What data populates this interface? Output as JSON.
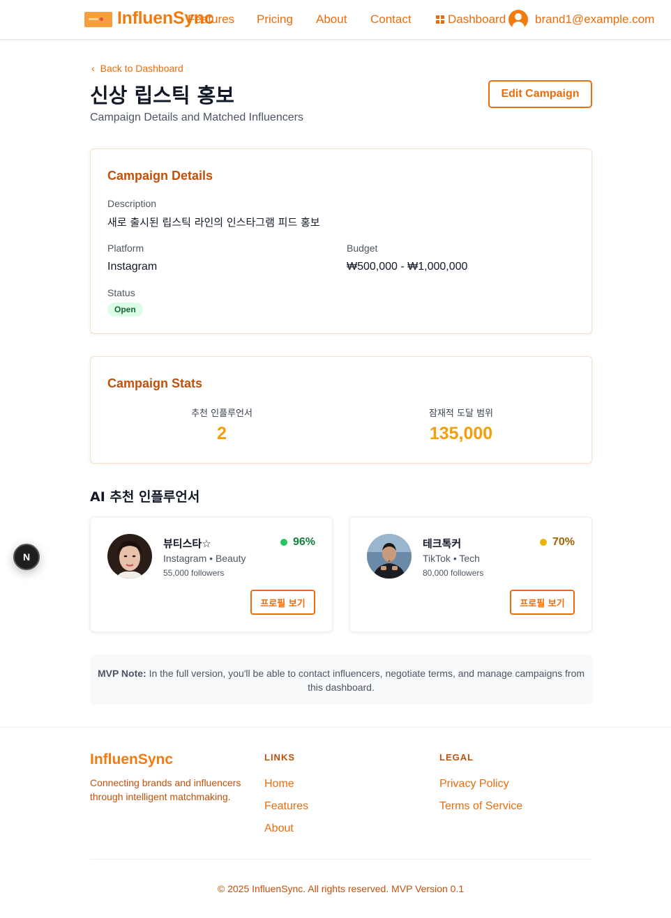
{
  "header": {
    "brand": "InfluenSync",
    "nav": [
      "Features",
      "Pricing",
      "About",
      "Contact"
    ],
    "dashboard_label": "Dashboard",
    "user_email": "brand1@example.com"
  },
  "page": {
    "back_label": "Back to Dashboard",
    "title": "신상 립스틱 홍보",
    "subtitle": "Campaign Details and Matched Influencers",
    "edit_button": "Edit Campaign"
  },
  "details": {
    "title": "Campaign Details",
    "description_label": "Description",
    "description": "새로 출시된 립스틱 라인의 인스타그램 피드 홍보",
    "platform_label": "Platform",
    "platform": "Instagram",
    "budget_label": "Budget",
    "budget": "₩500,000 - ₩1,000,000",
    "status_label": "Status",
    "status": "Open"
  },
  "stats": {
    "title": "Campaign Stats",
    "recommended_label": "추천 인플루언서",
    "recommended_value": "2",
    "reach_label": "잠재적 도달 범위",
    "reach_value": "135,000"
  },
  "influencers": {
    "title": "AI 추천 인플루언서",
    "items": [
      {
        "name": "뷰티스타☆",
        "platform": "Instagram",
        "category": "Beauty",
        "followers": "55,000 followers",
        "match": "96%",
        "match_color": "#22c55e",
        "match_text_color": "#15803d",
        "button": "프로필 보기"
      },
      {
        "name": "테크톡커",
        "platform": "TikTok",
        "category": "Tech",
        "followers": "80,000 followers",
        "match": "70%",
        "match_color": "#eab308",
        "match_text_color": "#a16207",
        "button": "프로필 보기"
      }
    ]
  },
  "mvp_note": {
    "label": "MVP Note:",
    "text": "In the full version, you'll be able to contact influencers, negotiate terms, and manage campaigns from this dashboard."
  },
  "next_badge": "N",
  "footer": {
    "brand": "InfluenSync",
    "tagline": "Connecting brands and influencers through intelligent matchmaking.",
    "links_heading": "LINKS",
    "links": [
      "Home",
      "Features",
      "About"
    ],
    "legal_heading": "LEGAL",
    "legal": [
      "Privacy Policy",
      "Terms of Service"
    ],
    "copyright": "© 2025 InfluenSync. All rights reserved. MVP Version 0.1"
  },
  "colors": {
    "accent": "#ea6c0c",
    "brand": "#f07c10",
    "heading_accent": "#c2500b",
    "stat_value": "#f59e0b"
  }
}
